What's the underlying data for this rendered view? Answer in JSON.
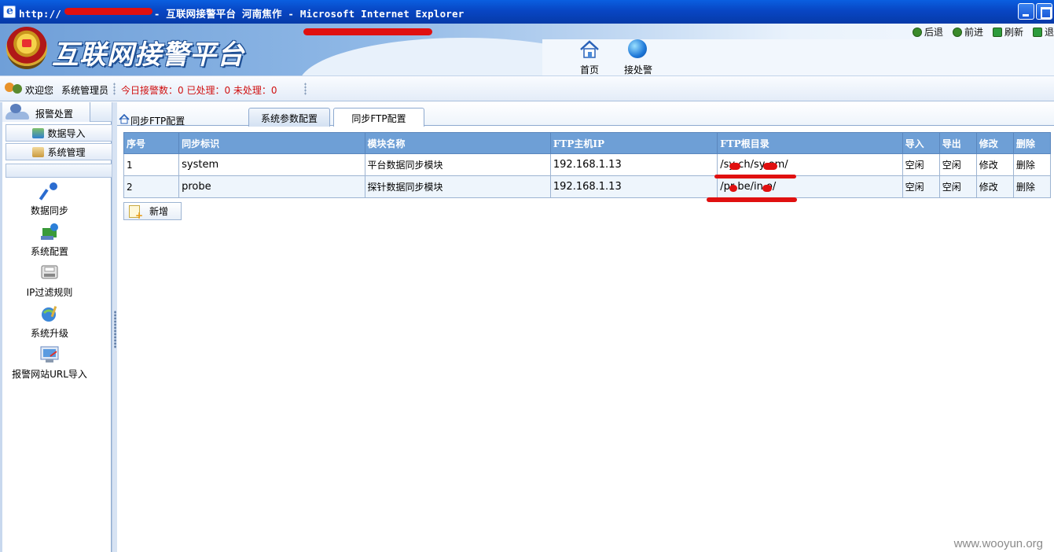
{
  "window": {
    "title_prefix": "http://",
    "title_rest": " - 互联网接警平台 河南焦作 - Microsoft Internet Explorer"
  },
  "header": {
    "logo_text": "互联网接警平台",
    "toplinks": [
      {
        "label": "后退",
        "icon": "back-arrow-icon"
      },
      {
        "label": "前进",
        "icon": "forward-arrow-icon"
      },
      {
        "label": "刷新",
        "icon": "refresh-icon"
      },
      {
        "label": "退",
        "icon": "logout-icon"
      }
    ],
    "nav": [
      {
        "label": "首页",
        "icon": "home-icon"
      },
      {
        "label": "接处警",
        "icon": "globe-icon"
      }
    ]
  },
  "welcome": {
    "label": "欢迎您",
    "user": "系统管理员",
    "stats": "今日接警数：0  已处理：0  未处理：0"
  },
  "sidebar": {
    "header": "报警处置",
    "menu": [
      {
        "label": "数据导入",
        "icon": "data-import-icon"
      },
      {
        "label": "系统管理",
        "icon": "system-manage-icon"
      }
    ],
    "tools": [
      {
        "label": "数据同步",
        "icon": "key-icon"
      },
      {
        "label": "系统配置",
        "icon": "config-icon"
      },
      {
        "label": "IP过滤规则",
        "icon": "filter-icon"
      },
      {
        "label": "系统升级",
        "icon": "upgrade-icon"
      },
      {
        "label": "报警网站URL导入",
        "icon": "url-import-icon"
      }
    ]
  },
  "main": {
    "breadcrumb": "同步FTP配置",
    "tabs": [
      "系统参数配置",
      "同步FTP配置"
    ],
    "active_tab": "同步FTP配置",
    "columns": [
      "序号",
      "同步标识",
      "模块名称",
      "FTP主机IP",
      "FTP根目录",
      "导入",
      "导出",
      "修改",
      "删除"
    ],
    "rows": [
      [
        "1",
        "system",
        "平台数据同步模块",
        "192.168.1.13",
        "/sy  ch/sy   em/",
        "空闲",
        "空闲",
        "修改",
        "删除"
      ],
      [
        "2",
        "probe",
        "探针数据同步模块",
        "192.168.1.13",
        "/pr  be/in  o/",
        "空闲",
        "空闲",
        "修改",
        "删除"
      ]
    ],
    "add_button": "新增"
  },
  "watermark": "www.wooyun.org",
  "colors": {
    "title_bar": "#0846c4",
    "table_header": "#6e9fd6",
    "stats_text": "#d01010",
    "redaction": "#e01010"
  }
}
